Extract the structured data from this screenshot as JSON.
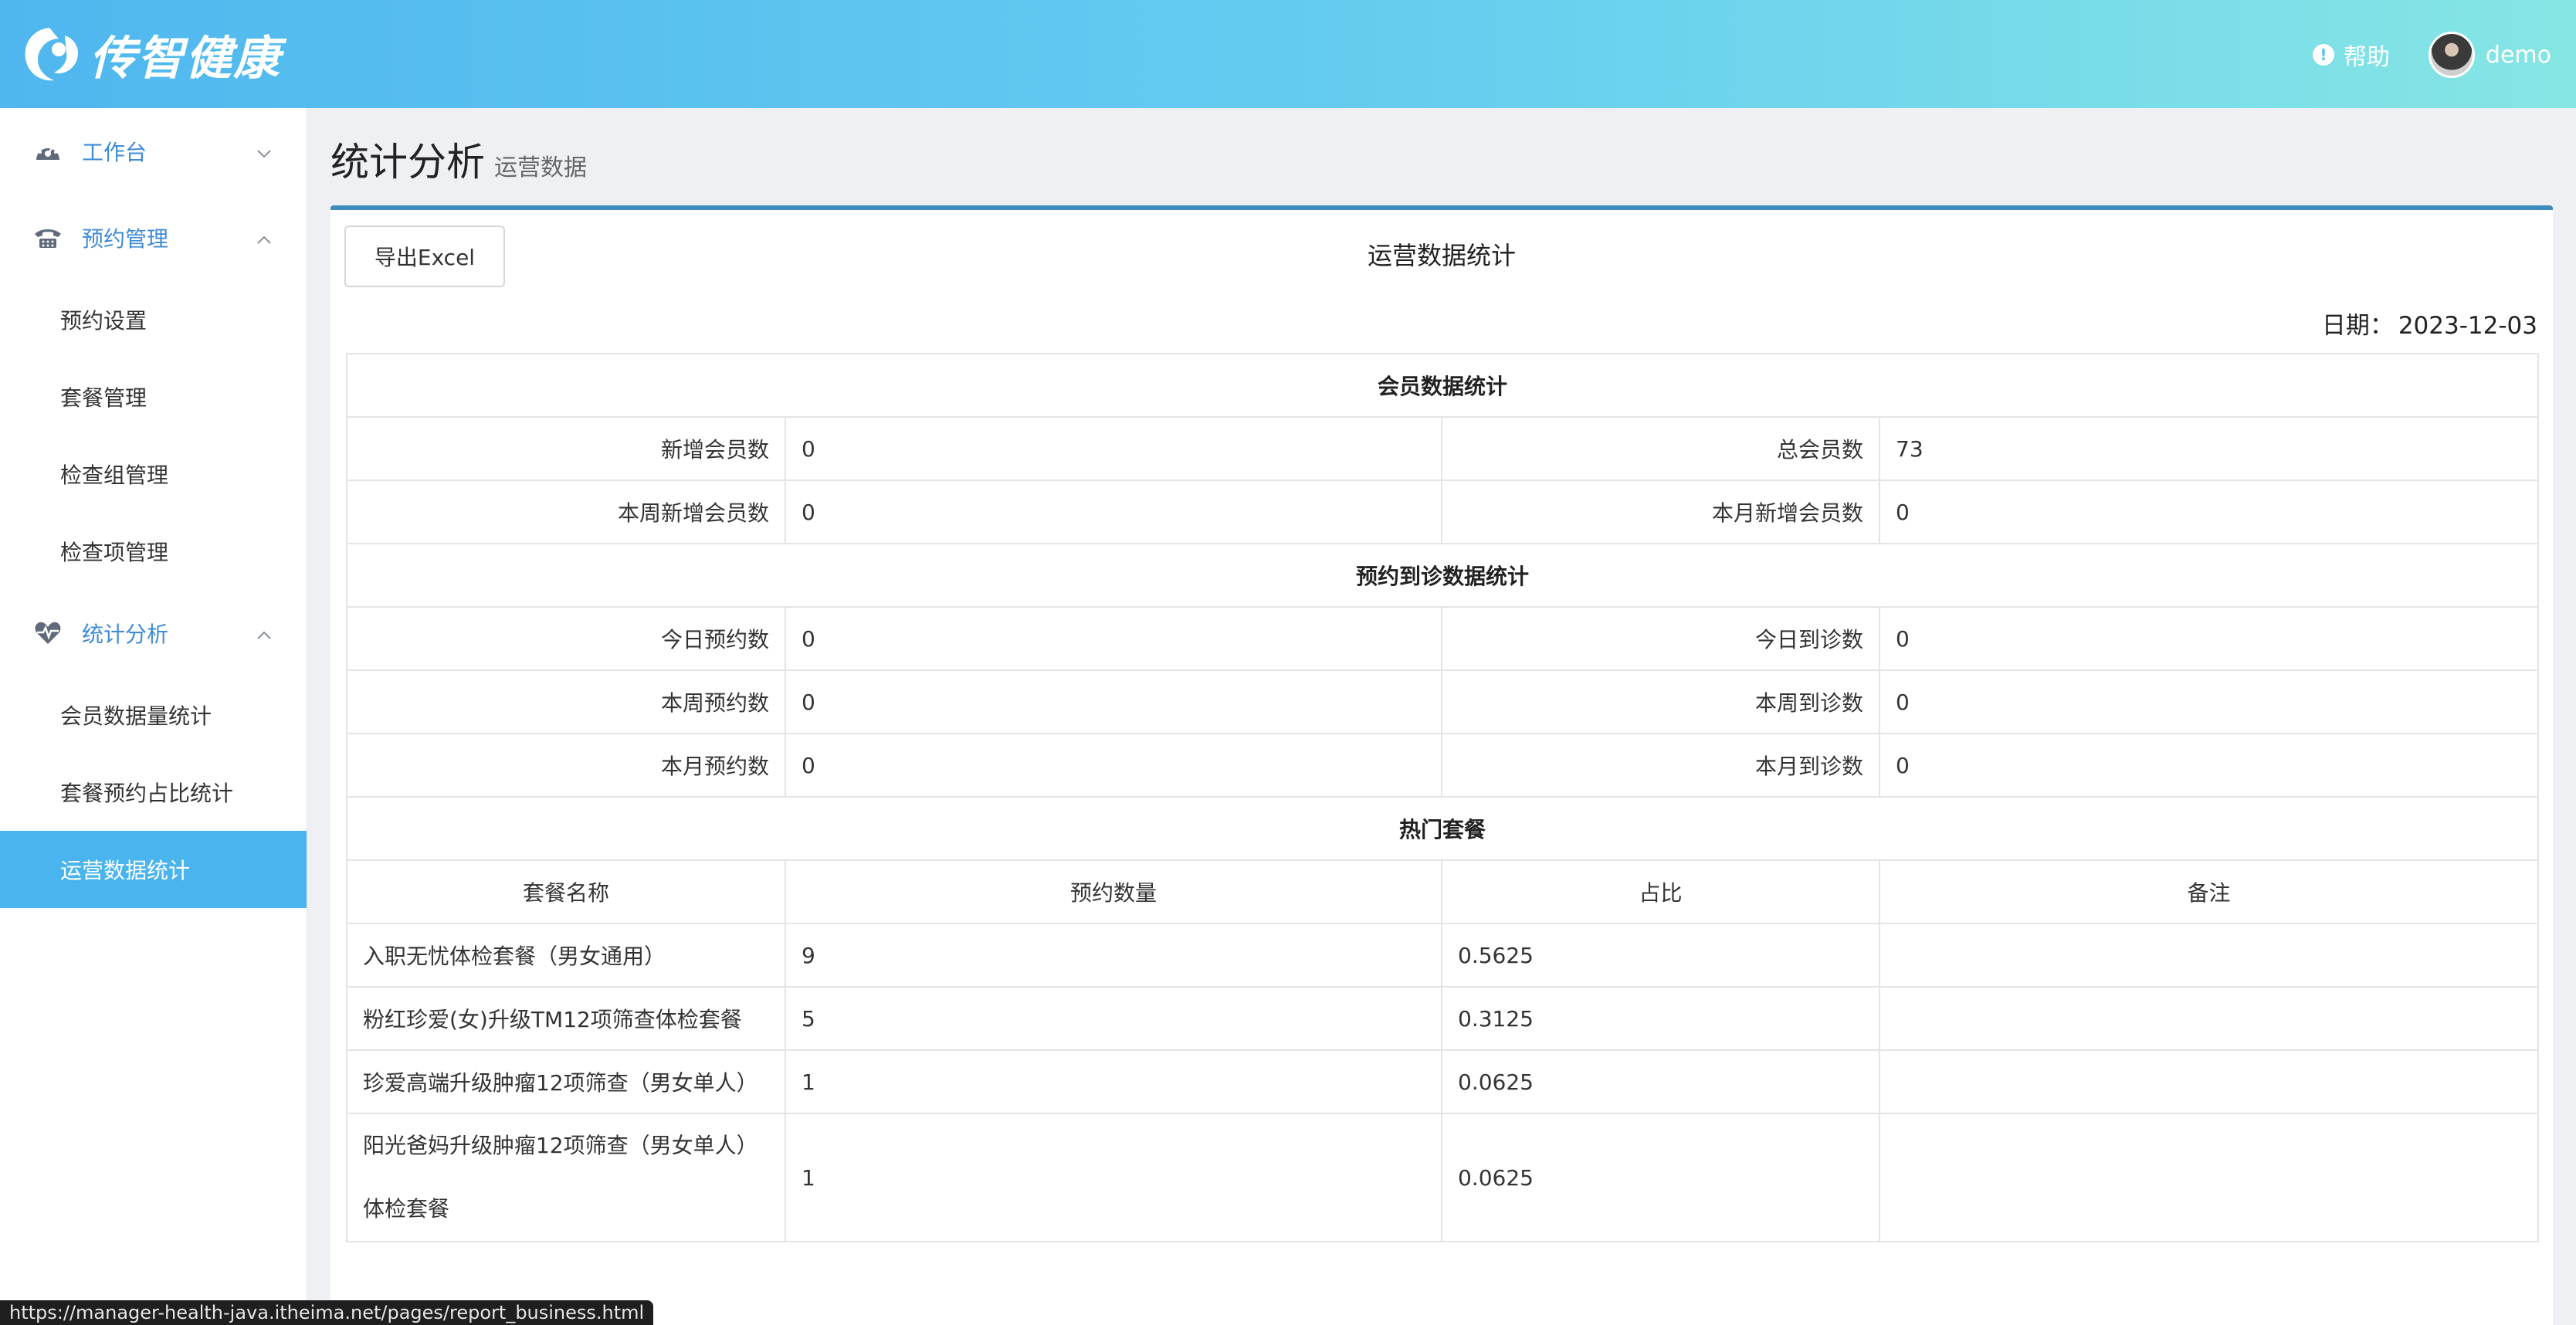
{
  "header": {
    "logo_text": "传智健康",
    "help_label": "帮助",
    "user_name": "demo"
  },
  "sidebar": {
    "groups": [
      {
        "label": "工作台",
        "icon": "dashboard-icon",
        "expanded": false,
        "items": []
      },
      {
        "label": "预约管理",
        "icon": "phone-icon",
        "expanded": true,
        "items": [
          "预约设置",
          "套餐管理",
          "检查组管理",
          "检查项管理"
        ]
      },
      {
        "label": "统计分析",
        "icon": "heartbeat-icon",
        "expanded": true,
        "items": [
          "会员数据量统计",
          "套餐预约占比统计",
          "运营数据统计"
        ]
      }
    ],
    "active_item": "运营数据统计"
  },
  "page": {
    "title": "统计分析",
    "subtitle": "运营数据"
  },
  "report": {
    "export_button": "导出Excel",
    "title": "运营数据统计",
    "date_label": "日期：",
    "date_value": "2023-12-03",
    "member_section": {
      "title": "会员数据统计",
      "rows": [
        {
          "l1": "新增会员数",
          "v1": "0",
          "l2": "总会员数",
          "v2": "73"
        },
        {
          "l1": "本周新增会员数",
          "v1": "0",
          "l2": "本月新增会员数",
          "v2": "0"
        }
      ]
    },
    "order_section": {
      "title": "预约到诊数据统计",
      "rows": [
        {
          "l1": "今日预约数",
          "v1": "0",
          "l2": "今日到诊数",
          "v2": "0"
        },
        {
          "l1": "本周预约数",
          "v1": "0",
          "l2": "本周到诊数",
          "v2": "0"
        },
        {
          "l1": "本月预约数",
          "v1": "0",
          "l2": "本月到诊数",
          "v2": "0"
        }
      ]
    },
    "hot_section": {
      "title": "热门套餐",
      "columns": [
        "套餐名称",
        "预约数量",
        "占比",
        "备注"
      ],
      "rows": [
        {
          "name": "入职无忧体检套餐（男女通用）",
          "count": "9",
          "ratio": "0.5625",
          "remark": ""
        },
        {
          "name": "粉红珍爱(女)升级TM12项筛查体检套餐",
          "count": "5",
          "ratio": "0.3125",
          "remark": ""
        },
        {
          "name": "珍爱高端升级肿瘤12项筛查（男女单人）",
          "count": "1",
          "ratio": "0.0625",
          "remark": ""
        },
        {
          "name_line1": "阳光爸妈升级肿瘤12项筛查（男女单人）",
          "name_line2": "体检套餐",
          "count": "1",
          "ratio": "0.0625",
          "remark": ""
        }
      ]
    }
  },
  "statusbar": {
    "url": "https://manager-health-java.itheima.net/pages/report_business.html"
  }
}
